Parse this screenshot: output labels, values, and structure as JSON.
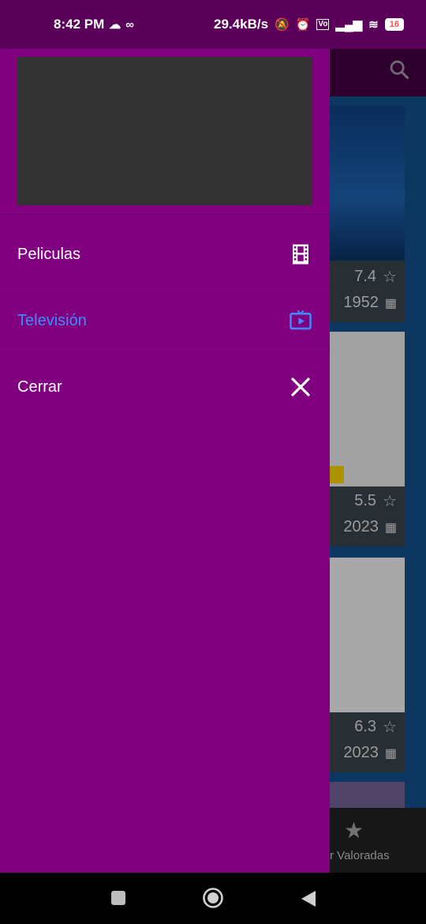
{
  "status_bar": {
    "time": "8:42 PM",
    "speed": "29.4kB/s",
    "battery": "16"
  },
  "background": {
    "cards": [
      {
        "rating": "7.4",
        "year": "1952"
      },
      {
        "rating": "5.5",
        "year": "2023"
      },
      {
        "rating": "6.3",
        "year": "2023"
      }
    ],
    "bottom_nav_label": "ejor Valoradas"
  },
  "drawer": {
    "items": [
      {
        "label": "Peliculas",
        "icon": "film-icon",
        "selected": false
      },
      {
        "label": "Televisión",
        "icon": "tv-icon",
        "selected": true
      },
      {
        "label": "Cerrar",
        "icon": "close-icon",
        "selected": false
      }
    ]
  },
  "colors": {
    "drawer_bg": "#800080",
    "selected": "#3d8bff",
    "status_bar": "#5a005a"
  }
}
